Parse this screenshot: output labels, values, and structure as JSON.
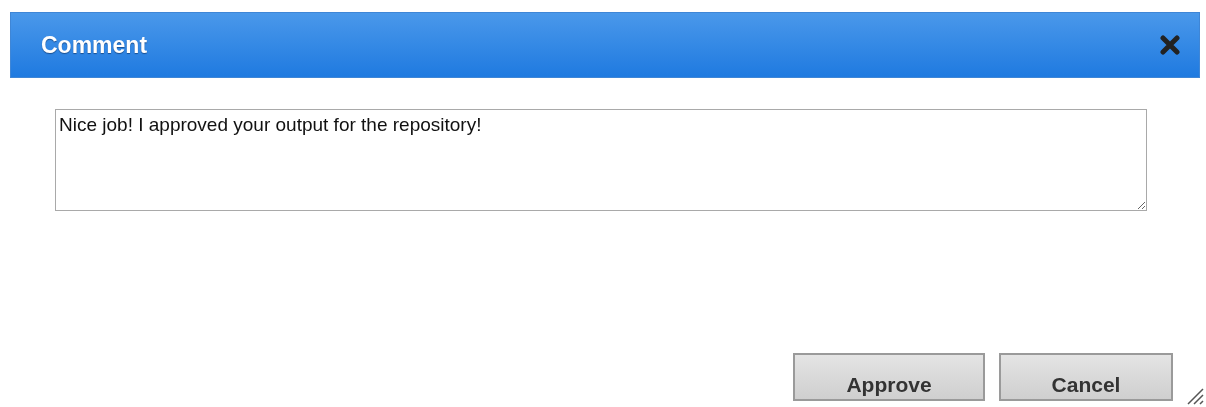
{
  "dialog": {
    "title": "Comment"
  },
  "comment_field": {
    "value": "Nice job! I approved your output for the repository!"
  },
  "buttons": [
    "Approve",
    "Cancel"
  ]
}
